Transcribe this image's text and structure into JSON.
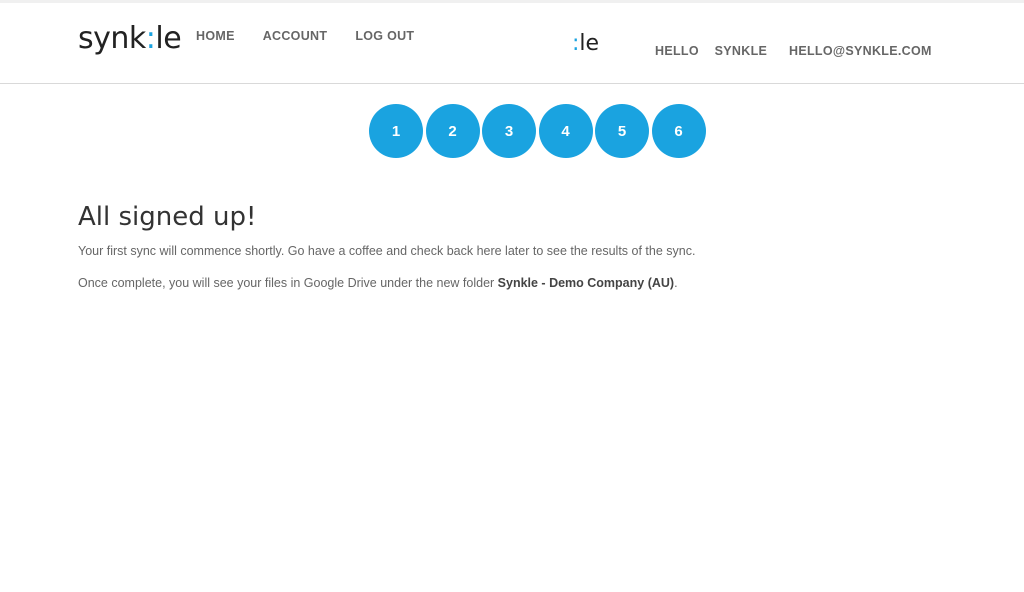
{
  "brand": {
    "logo_left": "synk",
    "logo_dots": ":",
    "logo_right": "le",
    "mini_dots": ":",
    "mini_right": "le",
    "accent": "#1aa3e0"
  },
  "nav": {
    "home": "HOME",
    "account": "ACCOUNT",
    "logout": "LOG OUT"
  },
  "user": {
    "hello": "HELLO",
    "name": "SYNKLE",
    "email": "HELLO@SYNKLE.COM"
  },
  "steps": [
    "1",
    "2",
    "3",
    "4",
    "5",
    "6"
  ],
  "main": {
    "title": "All signed up!",
    "line1": "Your first sync will commence shortly. Go have a coffee and check back here later to see the results of the sync.",
    "line2_prefix": "Once complete, you will see your files in Google Drive under the new folder ",
    "folder_name": "Synkle - Demo Company (AU)",
    "line2_suffix": "."
  }
}
